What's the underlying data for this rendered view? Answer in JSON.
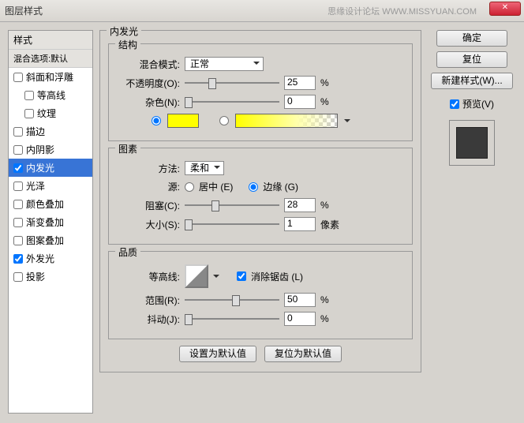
{
  "window": {
    "title": "图层样式",
    "watermark": "思缘设计论坛  WWW.MISSYUAN.COM"
  },
  "sidebar": {
    "header": "样式",
    "sub": "混合选项:默认",
    "items": [
      {
        "label": "斜面和浮雕",
        "checked": false,
        "indent": false
      },
      {
        "label": "等高线",
        "checked": false,
        "indent": true
      },
      {
        "label": "纹理",
        "checked": false,
        "indent": true
      },
      {
        "label": "描边",
        "checked": false,
        "indent": false
      },
      {
        "label": "内阴影",
        "checked": false,
        "indent": false
      },
      {
        "label": "内发光",
        "checked": true,
        "indent": false,
        "selected": true
      },
      {
        "label": "光泽",
        "checked": false,
        "indent": false
      },
      {
        "label": "颜色叠加",
        "checked": false,
        "indent": false
      },
      {
        "label": "渐变叠加",
        "checked": false,
        "indent": false
      },
      {
        "label": "图案叠加",
        "checked": false,
        "indent": false
      },
      {
        "label": "外发光",
        "checked": true,
        "indent": false
      },
      {
        "label": "投影",
        "checked": false,
        "indent": false
      }
    ]
  },
  "panel": {
    "title": "内发光",
    "structure": {
      "label": "结构",
      "blend_mode_label": "混合模式:",
      "blend_mode_value": "正常",
      "opacity_label": "不透明度(O):",
      "opacity_value": "25",
      "opacity_unit": "%",
      "noise_label": "杂色(N):",
      "noise_value": "0",
      "noise_unit": "%"
    },
    "elements": {
      "label": "图素",
      "technique_label": "方法:",
      "technique_value": "柔和",
      "source_label": "源:",
      "source_center": "居中 (E)",
      "source_edge": "边缘 (G)",
      "choke_label": "阻塞(C):",
      "choke_value": "28",
      "choke_unit": "%",
      "size_label": "大小(S):",
      "size_value": "1",
      "size_unit": "像素"
    },
    "quality": {
      "label": "品质",
      "contour_label": "等高线:",
      "antialias_label": "消除锯齿 (L)",
      "range_label": "范围(R):",
      "range_value": "50",
      "range_unit": "%",
      "jitter_label": "抖动(J):",
      "jitter_value": "0",
      "jitter_unit": "%"
    },
    "buttons": {
      "default": "设置为默认值",
      "reset": "复位为默认值"
    }
  },
  "right": {
    "ok": "确定",
    "cancel": "复位",
    "new_style": "新建样式(W)...",
    "preview": "预览(V)"
  }
}
